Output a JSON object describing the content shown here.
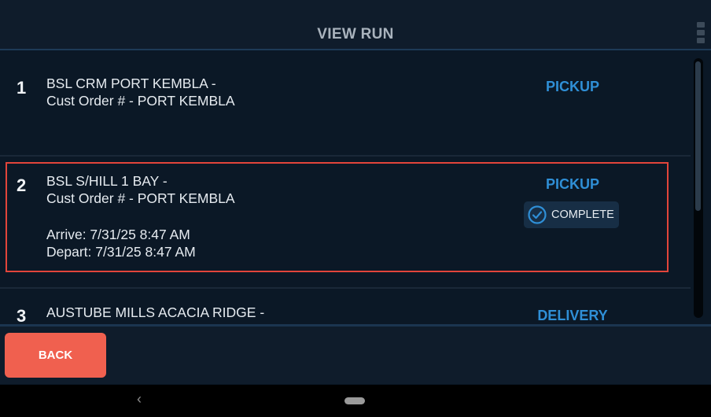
{
  "header": {
    "title": "VIEW RUN",
    "menu_icon": "hamburger-menu-icon"
  },
  "stops": [
    {
      "number": "1",
      "line1": "BSL CRM PORT KEMBLA -",
      "line2": "Cust Order # - PORT KEMBLA",
      "type": "PICKUP"
    },
    {
      "number": "2",
      "line1": "BSL S/HILL 1 BAY -",
      "line2": "Cust Order # - PORT KEMBLA",
      "arrive": "Arrive: 7/31/25 8:47 AM",
      "depart": "Depart: 7/31/25 8:47 AM",
      "type": "PICKUP",
      "status": "COMPLETE",
      "status_icon": "check-circle-icon",
      "selected": true
    },
    {
      "number": "3",
      "line1": "AUSTUBE MILLS ACACIA RIDGE -",
      "type": "DELIVERY"
    }
  ],
  "footer": {
    "back_label": "BACK"
  },
  "system_nav": {
    "back_glyph": "‹",
    "back_icon": "nav-back-icon",
    "home_icon": "nav-home-pill-icon"
  },
  "colors": {
    "accent_blue": "#2f8fd6",
    "back_button": "#f0604f",
    "selection_border": "#e2453b",
    "background": "#0b1826"
  }
}
